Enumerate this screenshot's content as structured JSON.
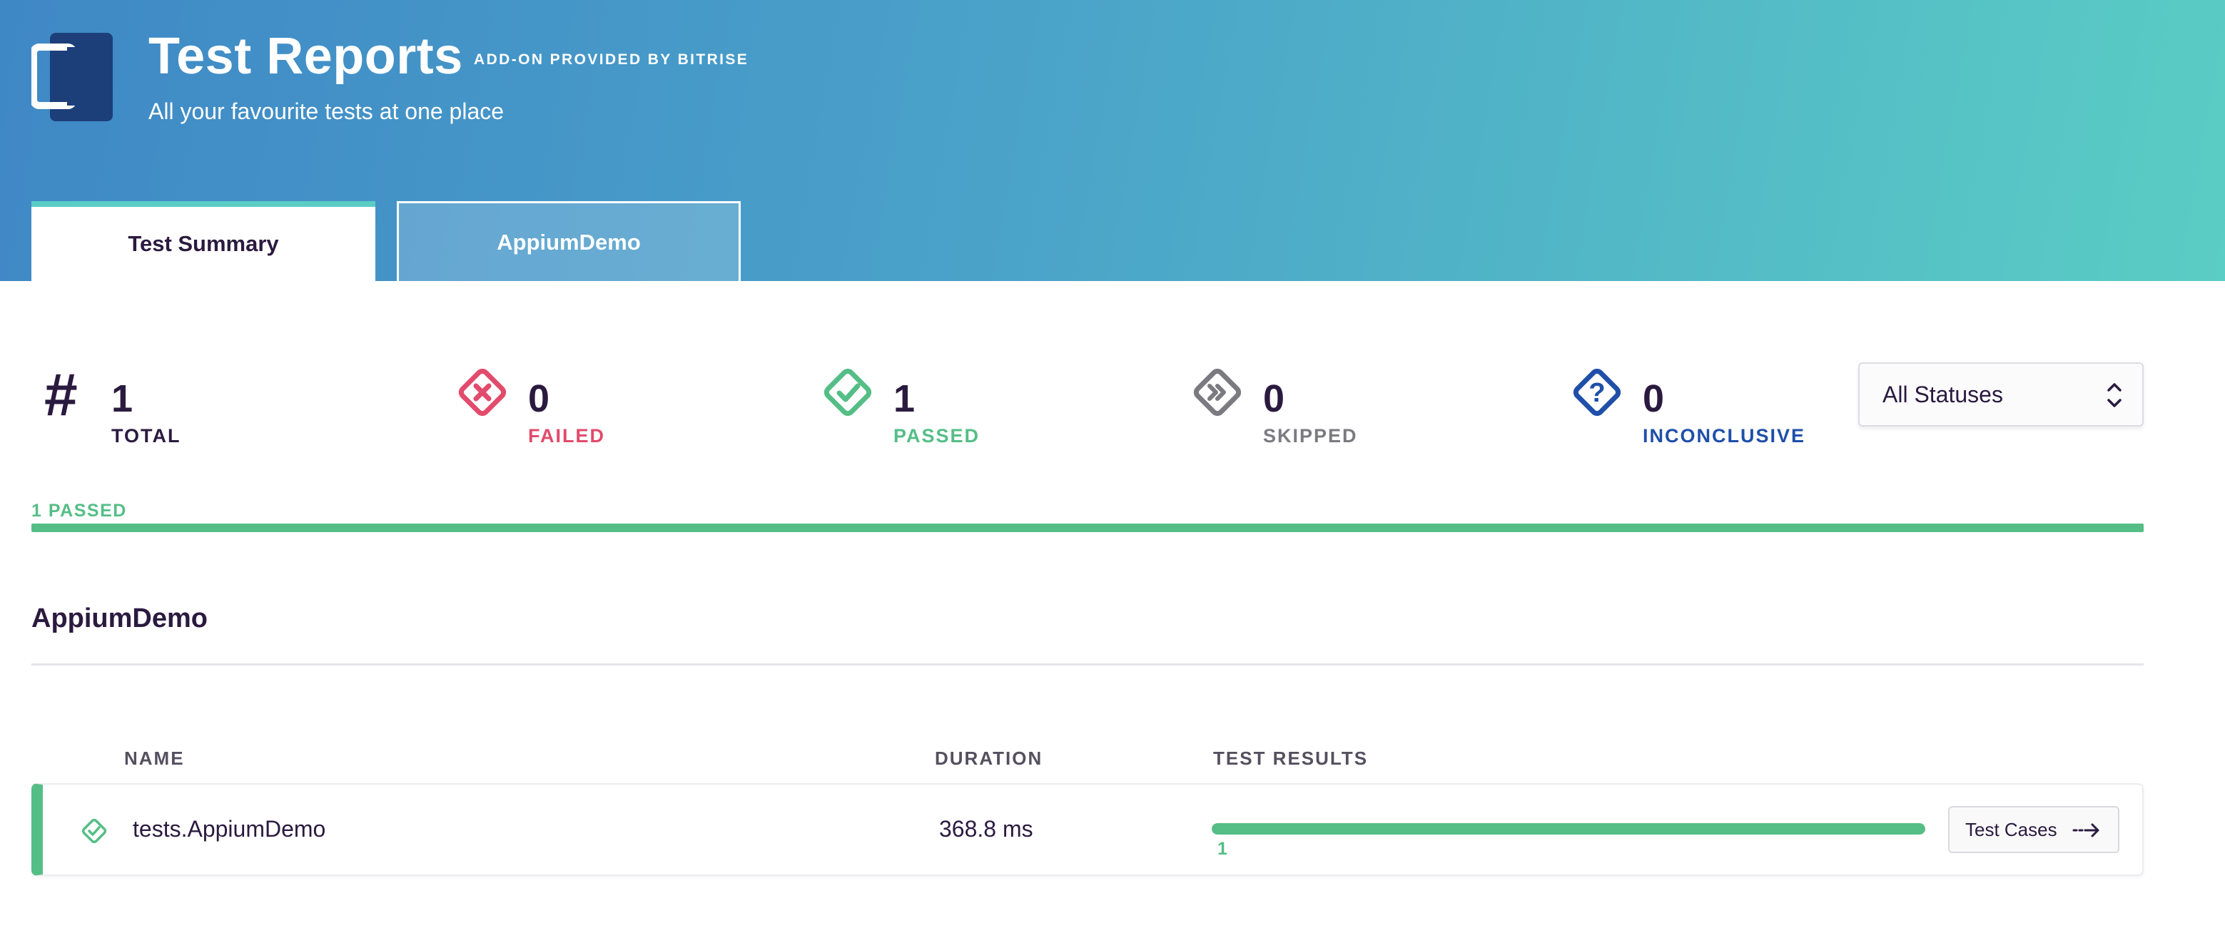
{
  "header": {
    "title": "Test Reports",
    "addon": "ADD-ON PROVIDED BY BITRISE",
    "subtitle": "All your favourite tests at one place",
    "logo_icon": "bitrise-test-reports-logo-icon"
  },
  "tabs": [
    {
      "label": "Test Summary",
      "active": true
    },
    {
      "label": "AppiumDemo",
      "active": false
    }
  ],
  "stats": {
    "total": {
      "value": "1",
      "label": "TOTAL",
      "icon": "hash-icon",
      "color": "#2b1a3f"
    },
    "failed": {
      "value": "0",
      "label": "FAILED",
      "icon": "failed-x-icon",
      "color": "#e24b6b"
    },
    "passed": {
      "value": "1",
      "label": "PASSED",
      "icon": "passed-check-icon",
      "color": "#55be86"
    },
    "skipped": {
      "value": "0",
      "label": "SKIPPED",
      "icon": "skipped-arrows-icon",
      "color": "#7a7a80"
    },
    "inconclusive": {
      "value": "0",
      "label": "INCONCLUSIVE",
      "icon": "inconclusive-question-icon",
      "color": "#1f4fa8"
    }
  },
  "filter": {
    "selected": "All Statuses"
  },
  "summary": {
    "caption": "1 PASSED",
    "passed_fraction": 1.0
  },
  "section": {
    "title": "AppiumDemo"
  },
  "table": {
    "columns": {
      "name": "NAME",
      "duration": "DURATION",
      "results": "TEST RESULTS"
    },
    "rows": [
      {
        "status": "passed",
        "name": "tests.AppiumDemo",
        "duration": "368.8 ms",
        "passed_count": "1",
        "passed_fraction": 1.0,
        "button_label": "Test Cases"
      }
    ]
  },
  "colors": {
    "header_gradient_start": "#3f88c6",
    "header_gradient_end": "#5acdc4",
    "passed": "#55be86",
    "failed": "#e24b6b",
    "skipped": "#7a7a80",
    "inconclusive": "#1f4fa8",
    "text_dark": "#2b1a3f"
  }
}
